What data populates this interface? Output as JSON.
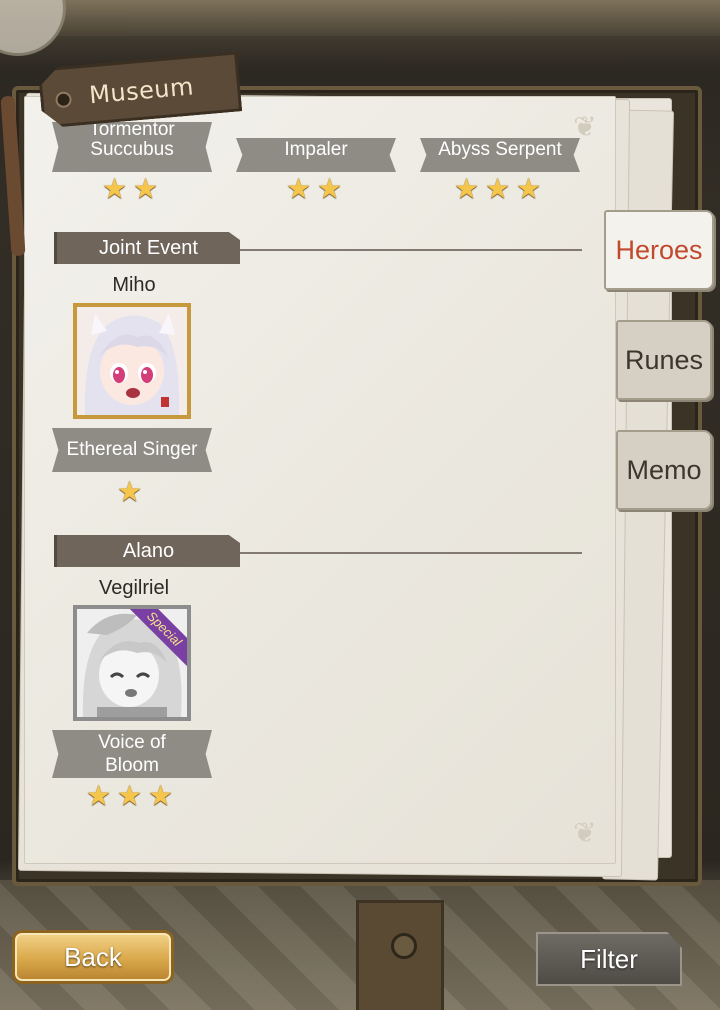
{
  "header": {
    "title": "Museum"
  },
  "top_row": [
    {
      "label_cut": "Tormentor",
      "label": "Succubus",
      "stars": 2
    },
    {
      "label": "Impaler",
      "stars": 2
    },
    {
      "label": "Abyss Serpent",
      "stars": 3
    }
  ],
  "sections": [
    {
      "title": "Joint Event",
      "hero": {
        "name": "Miho",
        "title": "Ethereal Singer",
        "stars": 1,
        "owned": true
      }
    },
    {
      "title": "Alano",
      "hero": {
        "name": "Vegilriel",
        "title_line1": "Voice of",
        "title_line2": "Bloom",
        "stars": 3,
        "owned": false,
        "badge": "Special"
      }
    }
  ],
  "tabs": [
    {
      "label": "Heroes",
      "active": true
    },
    {
      "label": "Runes",
      "active": false
    },
    {
      "label": "Memo",
      "active": false
    }
  ],
  "buttons": {
    "back": "Back",
    "filter": "Filter"
  },
  "colors": {
    "star": "#f5c64b",
    "active_tab_text": "#c1492e",
    "back_button": "#d9a84a"
  }
}
